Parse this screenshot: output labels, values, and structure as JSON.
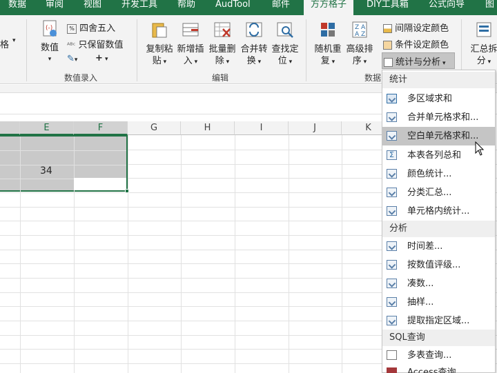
{
  "tabs": [
    {
      "label": "数据"
    },
    {
      "label": "审阅"
    },
    {
      "label": "视图"
    },
    {
      "label": "开发工具"
    },
    {
      "label": "帮助"
    },
    {
      "label": "AudTool"
    },
    {
      "label": "邮件"
    },
    {
      "label": "方方格子"
    },
    {
      "label": "DIY工具箱"
    },
    {
      "label": "公式向导"
    },
    {
      "label": "图"
    }
  ],
  "ribbon": {
    "left_cut": "格",
    "numeric_group": {
      "value_label": "数值",
      "round_label": "四舍五入",
      "keep_value_label": "只保留数值",
      "group_label": "数值录入"
    },
    "edit_group": {
      "buttons": [
        {
          "line1": "复制粘",
          "line2": "贴"
        },
        {
          "line1": "新增插",
          "line2": "入"
        },
        {
          "line1": "批量删",
          "line2": "除"
        },
        {
          "line1": "合并转",
          "line2": "换"
        },
        {
          "line1": "查找定",
          "line2": "位"
        }
      ],
      "group_label": "编辑"
    },
    "data_group": {
      "buttons": [
        {
          "line1": "随机重",
          "line2": "复"
        },
        {
          "line1": "高级排",
          "line2": "序"
        }
      ],
      "interval_color": "间隔设定颜色",
      "cond_color": "条件设定颜色",
      "stats": "统计与分析",
      "group_label": "数据"
    },
    "right_cut": {
      "line1": "汇总拆",
      "line2": "分"
    }
  },
  "sheet": {
    "columns": [
      "E",
      "F",
      "G",
      "H",
      "I",
      "J",
      "K"
    ],
    "cell_value": "34"
  },
  "menu": {
    "sections": [
      {
        "title": "统计",
        "items": [
          "多区域求和",
          "合并单元格求和...",
          "空白单元格求和...",
          "本表各列总和",
          "颜色统计...",
          "分类汇总...",
          "单元格内统计..."
        ]
      },
      {
        "title": "分析",
        "items": [
          "时间差...",
          "按数值评级...",
          "凑数...",
          "抽样...",
          "提取指定区域..."
        ]
      },
      {
        "title": "SQL查询",
        "items": [
          "多表查询...",
          "Access查询"
        ]
      }
    ],
    "hover_index": 2
  }
}
